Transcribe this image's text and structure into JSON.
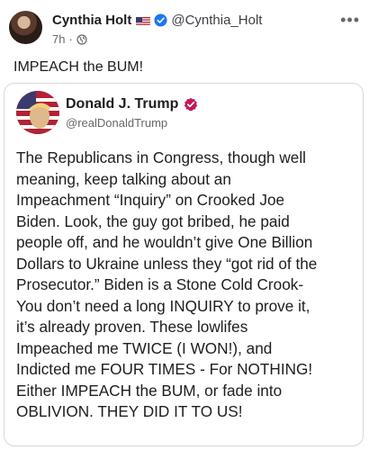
{
  "post": {
    "author_name": "Cynthia Holt",
    "handle": "@Cynthia_Holt",
    "time": "7h",
    "separator": "·",
    "more": "•••",
    "text": "IMPEACH the BUM!",
    "flag_icon": "us-flag-icon",
    "verified_icon": "verified-badge-icon",
    "visibility_icon": "globe-icon"
  },
  "quoted": {
    "author_name": "Donald J. Trump",
    "handle": "@realDonaldTrump",
    "verified_icon": "verified-badge-icon",
    "verified_color": "#c2185b",
    "body_lines": [
      "The Republicans in Congress, though well",
      "meaning, keep talking about an",
      "Impeachment “Inquiry” on Crooked Joe",
      "Biden. Look, the guy got bribed, he paid",
      "people off, and he wouldn’t give One Billion",
      "Dollars to Ukraine unless they “got rid of the",
      "Prosecutor.” Biden is a Stone Cold Crook-",
      "You don’t need a long INQUIRY to prove it,",
      "it’s already proven. These lowlifes",
      "Impeached me TWICE (I WON!), and",
      "Indicted me FOUR TIMES - For NOTHING!",
      "Either IMPEACH the BUM, or fade into",
      "OBLIVION. THEY DID IT TO US!"
    ]
  },
  "colors": {
    "verified_blue": "#1877f2",
    "text": "#1c1e21",
    "muted": "#65676b"
  }
}
